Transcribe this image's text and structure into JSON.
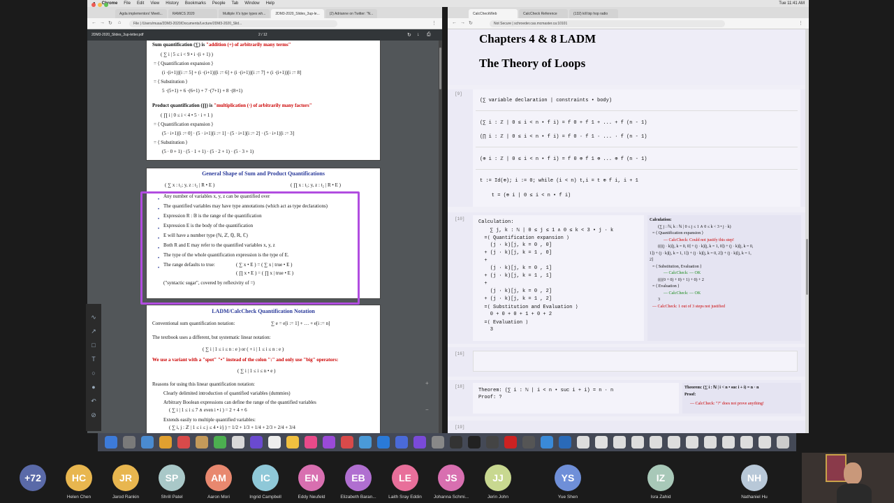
{
  "menubar": {
    "items": [
      "Chrome",
      "File",
      "Edit",
      "View",
      "History",
      "Bookmarks",
      "People",
      "Tab",
      "Window",
      "Help"
    ],
    "clock": "Tue 11:41 AM"
  },
  "left_window": {
    "tabs": [
      "Agda implementors' Meeti...",
      "RAMiCS 2020",
      "Multiple X's type types wh...",
      "2DM3-2020_Slides_3up-le...",
      "(2) Adrianne on Twitter: \"N..."
    ],
    "url": "File  |  /Users/musa/2DM3-2020/Documents/Lecture/2DM3-2020_Slid...",
    "pdf_title": "2DM3-2020_Slides_3up-letter.pdf",
    "pdf_page": "2 / 12"
  },
  "slide1": {
    "sum_head_a": "Sum quantification (∑) is ",
    "sum_head_b": "\"addition (+) of arbitrarily many terms\"",
    "l1": "( ∑ i  |  5 ≤ i < 9 • i ·(i + 1) )",
    "l2": "=  ⟨ Quantification expansion ⟩",
    "l3": "(i ·(i+1))[i := 5]   +   (i ·(i+1))[i := 6]   +   (i ·(i+1))[i := 7]   +   (i ·(i+1))[i := 8]",
    "l4": "=  ⟨ Substitution ⟩",
    "l5": "5 ·(5+1)   +   6 ·(6+1)   +   7 ·(7+1)   +   8 ·(8+1)",
    "prod_head_a": "Product quantification (∏) is ",
    "prod_head_b": "\"multiplication (·) of arbitrarily many factors\"",
    "p1": "( ∏ i  |  0 ≤ i < 4 • 5 · i + 1 )",
    "p2": "=  ⟨ Quantification expansion ⟩",
    "p3": "(5 · i+1)[i := 0]    ·    (5 · i+1)[i := 1]    ·    (5 · i+1)[i := 2]    ·    (5 · i+1)[i := 3]",
    "p4": "=  ⟨ Substitution ⟩",
    "p5": "(5 · 0 + 1)    ·    (5 · 1 + 1)    ·    (5 · 2 + 1)    ·    (5 · 3 + 1)"
  },
  "slide2": {
    "title": "General Shape of Sum and Product Quantifications",
    "shape_sum": "( ∑ x : t₁; y, z : t₂  |  R • E )",
    "shape_prod": "( ∏ x : t₁; y, z : t₂  |  R • E )",
    "b1": "Any number of variables x, y, z can be quantified over",
    "b2": "The quantified variables may have type annotations (which act as type declarations)",
    "b3": "Expression R : 𝔹 is the range of the quantification",
    "b4": "Expression E is the body of the quantification",
    "b5": "E will have a number type (ℕ, ℤ, ℚ, ℝ, ℂ)",
    "b6": "Both R and E may refer to the quantified variables x, y, z",
    "b7": "The type of the whole quantification expression is the type of E.",
    "b8": "The range defaults to true:",
    "b8a": "( ∑ x • E )   =   ( ∑ x  |  true • E )",
    "b8b": "( ∏ x • E )   =   ( ∏ x  |  true • E )",
    "b9": "(\"syntactic sugar\", covered by reflexivity of =)"
  },
  "slide3": {
    "title": "LADM/CalcCheck Quantification Notation",
    "t1": "Conventional sum quantification notation:",
    "t1m": "∑ e    =    e[i := 1] + … + e[i := n]",
    "t2": "The textbook uses a different, but systematic linear notation:",
    "t2m": "( ∑ i  |  1 ≤ i ≤ n : e )       or       ( + i  |  1 ≤ i ≤ n : e )",
    "t3": "We use a variant with a \"spot\" \"•\" instead of the colon \":\" and only use \"big\" operators:",
    "t3m": "( ∑ i  |  1 ≤ i ≤ n • e )",
    "t4": "Reasons for using this linear quantification notation:",
    "t5": "Clearly delimited introduction of quantified variables (dummies)",
    "t6": "Arbitrary Boolean expressions can define the range of the quantified variables",
    "t6m": "( ∑ i  |  1 ≤ i ≤ 7 ∧ even i • i ) = 2 + 4 + 6",
    "t7": "Extends easily to multiple quantified variables:",
    "t7m": "( ∑ i, j : ℤ  |  1 ≤ i ≤ j ≤ 4 • i/j ) = 1/2 + 1/3 + 1/4 + 2/3 + 2/4 + 3/4"
  },
  "right_window": {
    "tabs": [
      "CalcCheckWeb",
      "CalcCheck Reference",
      "(132) kill bip hop radio"
    ],
    "url": "Not Secure  |  schroeder.cas.mcmaster.ca:10101"
  },
  "cc": {
    "h1": "Chapters 4 & 8 LADM",
    "h2": "The Theory of Loops",
    "c9": "[9]",
    "c9_lines": [
      "(∑ variable declaration | constraints • body)",
      "(∑ i : ℤ | 0 ≤ i < n • f i) = f 0 + f 1 + ... + f (n - 1)",
      "(∏ i : ℤ | 0 ≤ i < n • f i) = f 0 · f 1 · ... · f (n - 1)",
      "(⊕ i : ℤ | 0 ≤ i < n • f i) = f 0 ⊕ f 1 ⊕ ... ⊕ f (n - 1)",
      "t := Id(⊕); i := 0; while (i < n) t,i = t ⊕ f i, i + 1",
      "    t = (⊕ i | 0 ≤ i < n • f i)"
    ],
    "c10": "[10]",
    "c10_lines": [
      "Calculation:",
      "    ∑ j, k : ℕ | 0 ≤ j ≤ 1 ∧ 0 ≤ k < 3 • j · k",
      "  =⟨ Quantification expansion ⟩",
      "    (j · k)[j, k = 0 , 0]",
      "  + (j · k)[j, k = 1 , 0]",
      "  +",
      "    (j · k)[j, k = 0 , 1]",
      "  + (j · k)[j, k = 1 , 1]",
      "  +",
      "    (j · k)[j, k = 0 , 2]",
      "  + (j · k)[j, k = 1 , 2]",
      "  =⟨ Substitution and Evaluation ⟩",
      "    0 + 0 + 0 + 1 + 0 + 2",
      "  =⟨ Evaluation ⟩",
      "    3"
    ],
    "fb10": {
      "title": "Calculation:",
      "l1": "(∑ j : ℕ, k : ℕ | 0 ≤ j ≤ 1 ∧ 0 ≤ k < 3 • j · k)",
      "l2": "= ⟨ Quantification expansion ⟩",
      "l3": "— CalcCheck: Could not justify this step!",
      "l4": "((((j · k)[j, k = 0, 0] + (j · k)[j, k = 1, 0]) + (j · k)[j, k = 0,",
      "l5": "1]) + (j · k)[j, k = 1, 1]) + (j · k)[j, k = 0, 2]) + (j · k)[j, k = 1,",
      "l6": "2]",
      "l7": "= ⟨ Substitution, Evaluation ⟩",
      "l8": "— CalcCheck: — OK",
      "l9": "((((0 + 0) + 0) + 1) + 0) + 2",
      "l10": "= ⟨ Evaluation ⟩",
      "l11": "— CalcCheck: — OK",
      "l12": "3",
      "l13": "— CalcCheck: 1 out of 3 steps not justified"
    },
    "c16": "[16]",
    "c18": "[18]",
    "c18_lines": [
      "Theorem: (∑ i : ℕ | i < n • suc i + i) = n · n",
      "Proof: ?"
    ],
    "fb18": {
      "l1": "Theorem: (∑ i : ℕ | i < n • suc i + i) = n · n",
      "l2": "Proof:",
      "l3": "— CalcCheck: \"?\" does not prove anything!"
    },
    "c19": "[19]"
  },
  "participants": [
    {
      "initials": "+72",
      "name": "",
      "color": "#5a6aa8"
    },
    {
      "initials": "HC",
      "name": "Helen Chen",
      "color": "#e8b64f"
    },
    {
      "initials": "JR",
      "name": "Jarod Rankin",
      "color": "#e8b64f"
    },
    {
      "initials": "SP",
      "name": "Shrill Patel",
      "color": "#a9c8c8"
    },
    {
      "initials": "AM",
      "name": "Aaron Mori",
      "color": "#e8886f"
    },
    {
      "initials": "IC",
      "name": "Ingrid Campbell",
      "color": "#8fc8d8"
    },
    {
      "initials": "EN",
      "name": "Eddy Neufeld",
      "color": "#d86fb0"
    },
    {
      "initials": "EB",
      "name": "Elizabeth Baran...",
      "color": "#b06fd0"
    },
    {
      "initials": "LE",
      "name": "Laith Sray Eddin",
      "color": "#e86f9a"
    },
    {
      "initials": "JS",
      "name": "Johanna Schmi...",
      "color": "#d86fb0"
    },
    {
      "initials": "JJ",
      "name": "Jerin John",
      "color": "#c8d890"
    },
    {
      "initials": "YS",
      "name": "Yue Shen",
      "color": "#6f8fd8"
    },
    {
      "initials": "IZ",
      "name": "Isra Zahid",
      "color": "#a8c8b8"
    },
    {
      "initials": "NH",
      "name": "Nathaniel Hu",
      "color": "#b8c8d8"
    }
  ]
}
